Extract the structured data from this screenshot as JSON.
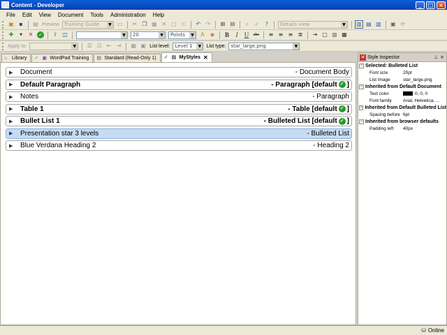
{
  "window": {
    "title": "Content - Developer"
  },
  "menu": [
    "File",
    "Edit",
    "View",
    "Document",
    "Tools",
    "Administration",
    "Help"
  ],
  "toolbar1": {
    "preview_label": "Preview",
    "template_value": "Training Guide",
    "view_value": "Details view"
  },
  "toolbar2": {
    "style_value": "",
    "font_size_value": "20",
    "unit_value": "Points",
    "bold": "B",
    "italic": "I",
    "underline": "U",
    "strike": "abc"
  },
  "toolbar3": {
    "apply_to_label": "Apply to:",
    "list_level_label": "List level:",
    "list_level_value": "Level 1",
    "list_type_label": "List type:",
    "list_type_value": "star_large.png"
  },
  "tabs": [
    {
      "label": "Library",
      "active": false
    },
    {
      "label": "WordPad Training",
      "active": false
    },
    {
      "label": "Standard (Read-Only 1)",
      "active": false
    },
    {
      "label": "MyStyles",
      "active": true
    }
  ],
  "styles": [
    {
      "name": "Document",
      "style": "- Document Body",
      "default": false,
      "bold": false,
      "selected": false
    },
    {
      "name": "Default Paragraph",
      "style": "- Paragraph [default",
      "default": true,
      "bold": true,
      "selected": false
    },
    {
      "name": "Notes",
      "style": "- Paragraph",
      "default": false,
      "bold": false,
      "selected": false
    },
    {
      "name": "Table 1",
      "style": "- Table [default",
      "default": true,
      "bold": true,
      "selected": false
    },
    {
      "name": "Bullet List 1",
      "style": "- Bulleted List [default",
      "default": true,
      "bold": true,
      "selected": false
    },
    {
      "name": "Presentation star 3 levels",
      "style": "- Bulleted List",
      "default": false,
      "bold": false,
      "selected": true
    },
    {
      "name": "Blue Verdana Heading 2",
      "style": "- Heading 2",
      "default": false,
      "bold": false,
      "selected": false
    }
  ],
  "default_suffix": "]",
  "inspector": {
    "title": "Style Inspector",
    "sections": [
      {
        "heading": "Selected: Bulleted List",
        "props": [
          {
            "name": "Font size",
            "value": "20pt"
          },
          {
            "name": "List image",
            "value": "star_large.png"
          }
        ]
      },
      {
        "heading": "Inherited from Default Document",
        "props": [
          {
            "name": "Text color",
            "value": "0, 0, 0",
            "swatch": "#000000"
          },
          {
            "name": "Font family",
            "value": "Arial, Helvetica, ..."
          }
        ]
      },
      {
        "heading": "Inherited from Default Bulleted List",
        "props": [
          {
            "name": "Spacing before",
            "value": "6pt"
          }
        ]
      },
      {
        "heading": "Inherited from browser defaults",
        "props": [
          {
            "name": "Padding left",
            "value": "40px"
          }
        ]
      }
    ]
  },
  "status": {
    "text": "Online"
  },
  "colors": {
    "selected_row": "#c5dcf4",
    "title_bar": "#0a5fd8",
    "default_check": "#2a9a2a"
  }
}
